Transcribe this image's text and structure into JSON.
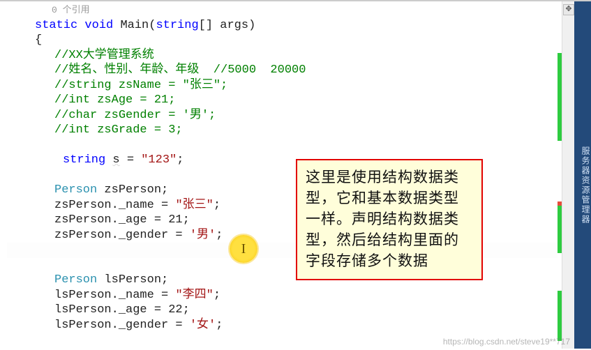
{
  "codelens": "0 个引用",
  "code": {
    "sig_static": "static",
    "sig_void": "void",
    "sig_main": "Main",
    "sig_open": "(",
    "sig_string": "string",
    "sig_brackets": "[]",
    "sig_args": " args)",
    "brace_open": "{",
    "c1": "//XX大学管理系统",
    "c2": "//姓名、性别、年龄、年级  //5000  20000",
    "c3": "//string zsName = \"张三\";",
    "c4": "//int zsAge = 21;",
    "c5": "//char zsGender = '男';",
    "c6": "//int zsGrade = 3;",
    "s_kw": "string",
    "s_id": "s",
    "s_eq": " = ",
    "s_val": "\"123\"",
    "semi": ";",
    "p_type": "Person",
    "zs_decl": " zsPerson;",
    "zs_name_lhs": "zsPerson._name = ",
    "zs_name_val": "\"张三\"",
    "zs_age": "zsPerson._age = 21;",
    "zs_gender_lhs": "zsPerson._gender = ",
    "zs_gender_val": "'男'",
    "ls_decl": " lsPerson;",
    "ls_name_lhs": "lsPerson._name = ",
    "ls_name_val": "\"李四\"",
    "ls_age": "lsPerson._age = 22;",
    "ls_gender_lhs": "lsPerson._gender = ",
    "ls_gender_val": "'女'"
  },
  "annotation_text": "这里是使用结构数据类型，它和基本数据类型一样。声明结构数据类型，然后给结构里面的字段存储多个数据",
  "cursor_glyph": "I",
  "scroll_up": "⬛",
  "right_panel_label": "服务器资源管理器",
  "watermark": "https://blog.csdn.net/steve19**717"
}
